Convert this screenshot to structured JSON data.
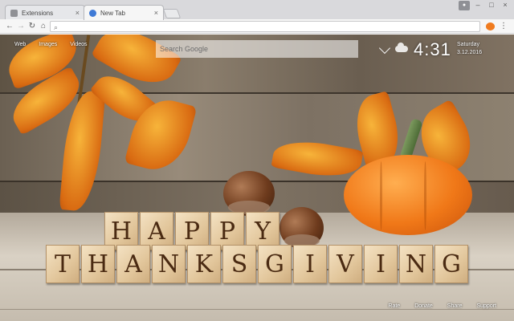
{
  "browser": {
    "tabs": [
      {
        "label": "Extensions",
        "icon": "puzzle-icon"
      },
      {
        "label": "New Tab",
        "icon": "newtab-icon"
      }
    ],
    "omnibox_value": "",
    "close_glyph": "×",
    "window_controls": [
      "–",
      "□",
      "×"
    ]
  },
  "newtab": {
    "top_links": [
      "Web",
      "Images",
      "Videos"
    ],
    "search_placeholder": "Search Google",
    "time": "4:31",
    "day": "Saturday",
    "date": "3.12.2016",
    "bottom_links": [
      "Rate",
      "Donate",
      "Share",
      "Support"
    ]
  },
  "image": {
    "blocks_row1": [
      "H",
      "A",
      "P",
      "P",
      "Y"
    ],
    "blocks_row2": [
      "T",
      "H",
      "A",
      "N",
      "K",
      "S",
      "G",
      "I",
      "V",
      "I",
      "N",
      "G"
    ]
  },
  "colors": {
    "accent_tab": "#3f7ad6",
    "pumpkin": "#f07818",
    "block_text": "#4a2a12"
  }
}
